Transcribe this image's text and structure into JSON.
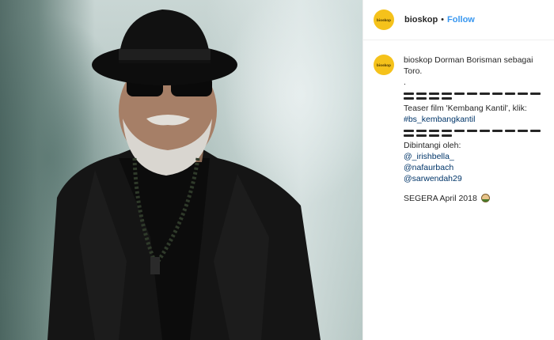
{
  "post": {
    "photo_alt": "Dorman Borisman sebagai Toro"
  },
  "header": {
    "avatar_text": "bioskop",
    "username": "bioskop",
    "separator": "•",
    "follow_label": "Follow"
  },
  "caption": {
    "avatar_text": "bioskop",
    "username": "bioskop",
    "text_1": "Dorman Borisman sebagai Toro.",
    "dot": ".",
    "dashes_1_count": 15,
    "teaser_text": "Teaser film 'Kembang Kantil', klik: ",
    "hashtag": "#bs_kembangkantil",
    "dashes_2_count": 15,
    "starring_label": "Dibintangi oleh:",
    "mentions": [
      "@_irishbella_",
      "@nafaurbach",
      "@sarwendah29"
    ],
    "release_text": "SEGERA April 2018"
  }
}
